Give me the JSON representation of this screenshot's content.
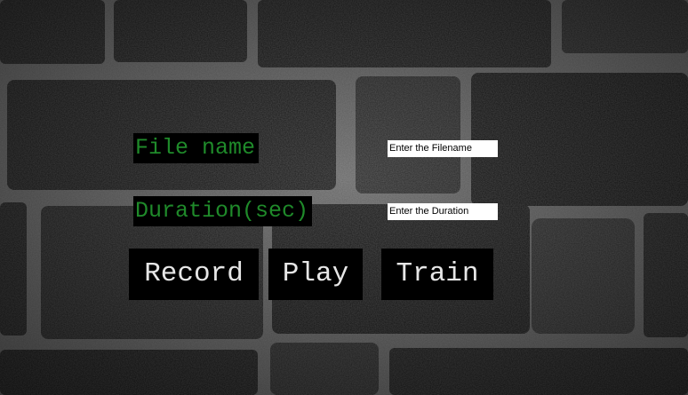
{
  "colors": {
    "label_text": "#1f8a2a",
    "button_text": "#e6e6e6",
    "widget_bg": "#000000",
    "entry_bg": "#ffffff",
    "background": "brick-wall-texture"
  },
  "form": {
    "filename_label": "File name",
    "filename_value": "Enter the Filename",
    "duration_label": "Duration(sec)",
    "duration_value": "Enter the Duration"
  },
  "buttons": {
    "record_label": "Record",
    "play_label": "Play",
    "train_label": "Train"
  }
}
